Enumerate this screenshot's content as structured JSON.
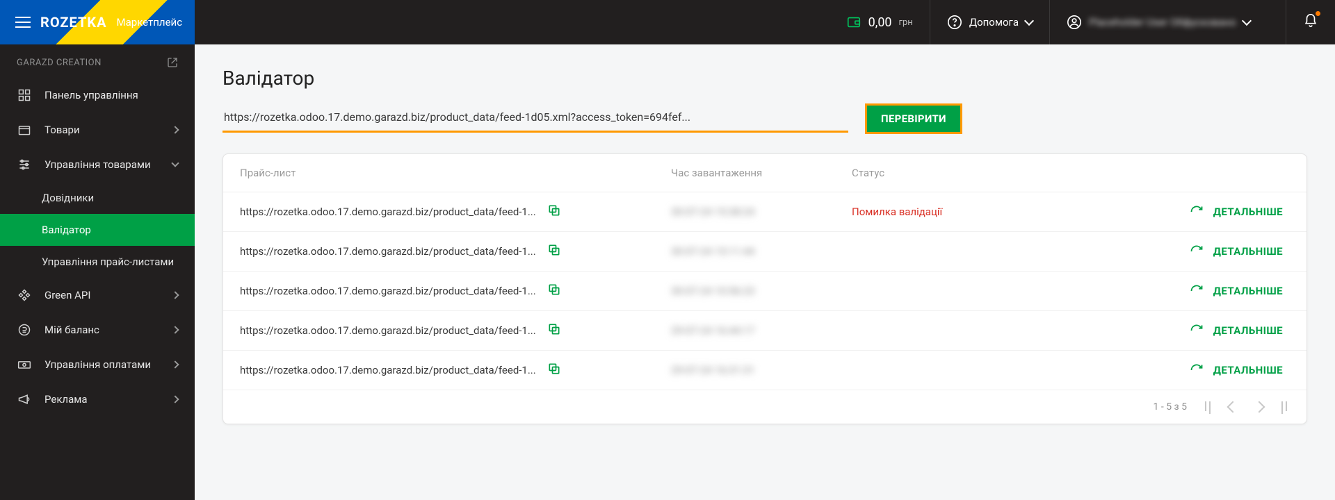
{
  "header": {
    "logo": "ROZETKA",
    "sub": "Маркетплейс",
    "balance_amount": "0,00",
    "balance_currency": "грн",
    "help": "Допомога",
    "user_name_obscured": "Placeholder User Обфусковано"
  },
  "sidebar": {
    "org": "GARAZD CREATION",
    "items": [
      {
        "label": "Панель управління"
      },
      {
        "label": "Товари",
        "expandable": true
      },
      {
        "label": "Управління товарами",
        "expandable": true,
        "open": true,
        "children": [
          {
            "label": "Довідники"
          },
          {
            "label": "Валідатор",
            "active": true
          },
          {
            "label": "Управління прайс-листами"
          }
        ]
      },
      {
        "label": "Green API",
        "expandable": true
      },
      {
        "label": "Мій баланс",
        "expandable": true
      },
      {
        "label": "Управління оплатами",
        "expandable": true
      },
      {
        "label": "Реклама",
        "expandable": true
      }
    ]
  },
  "page": {
    "title": "Валідатор",
    "url_value": "https://rozetka.odoo.17.demo.garazd.biz/product_data/feed-1d05.xml?access_token=694fef...",
    "check_btn": "ПЕРЕВІРИТИ"
  },
  "table": {
    "cols": {
      "feed": "Прайс-лист",
      "time": "Час завантаження",
      "status": "Статус"
    },
    "detail_label": "ДЕТАЛЬНІШЕ",
    "rows": [
      {
        "feed": "https://rozetka.odoo.17.demo.garazd.biz/product_data/feed-1...",
        "time_obscured": "30-07-24 15:38:24",
        "status": "Помилка валідації"
      },
      {
        "feed": "https://rozetka.odoo.17.demo.garazd.biz/product_data/feed-1...",
        "time_obscured": "30-07-24 15:11:44",
        "status": ""
      },
      {
        "feed": "https://rozetka.odoo.17.demo.garazd.biz/product_data/feed-1...",
        "time_obscured": "30-07-24 10:56:23",
        "status": ""
      },
      {
        "feed": "https://rozetka.odoo.17.demo.garazd.biz/product_data/feed-1...",
        "time_obscured": "29-07-24 16:44:17",
        "status": ""
      },
      {
        "feed": "https://rozetka.odoo.17.demo.garazd.biz/product_data/feed-1...",
        "time_obscured": "29-07-24 16:31:31",
        "status": ""
      }
    ],
    "pager_text": "1 - 5 з 5"
  }
}
